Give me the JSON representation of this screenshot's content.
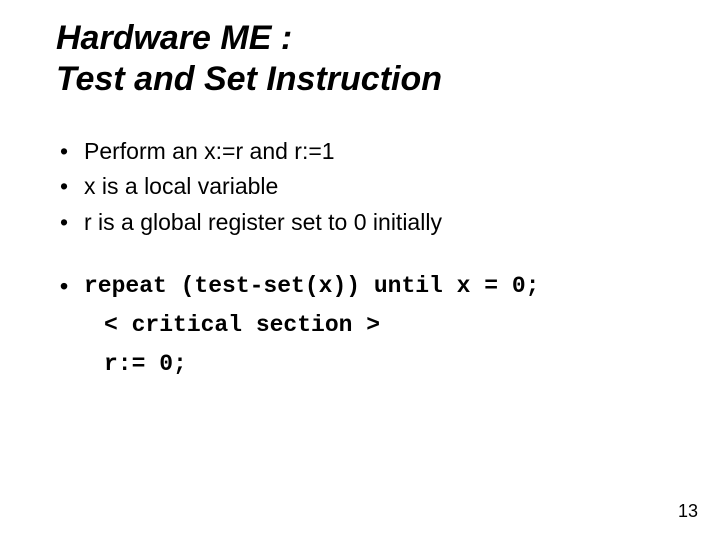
{
  "title": {
    "line1": "Hardware ME :",
    "line2": "Test and Set Instruction"
  },
  "bullets": [
    "Perform an x:=r and r:=1",
    "x is a local variable",
    "r is a global register set to 0 initially"
  ],
  "code": {
    "line1": "repeat (test-set(x)) until x = 0;",
    "line2": "< critical section >",
    "line3": "r:= 0;"
  },
  "pagenum": "13"
}
